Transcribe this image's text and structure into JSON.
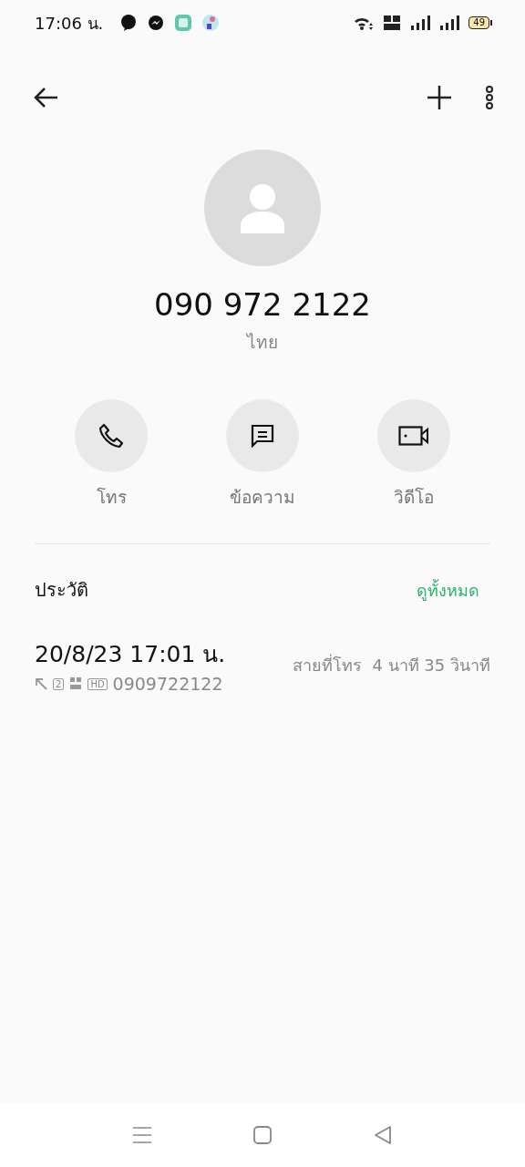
{
  "status_bar": {
    "time": "17:06 น.",
    "battery": "49"
  },
  "contact": {
    "number": "090 972 2122",
    "location": "ไทย"
  },
  "actions": [
    {
      "kind": "call",
      "label": "โทร"
    },
    {
      "kind": "message",
      "label": "ข้อความ"
    },
    {
      "kind": "video",
      "label": "วิดีโอ"
    }
  ],
  "history": {
    "title": "ประวัติ",
    "see_all": "ดูทั้งหมด",
    "entries": [
      {
        "datetime": "20/8/23 17:01 น.",
        "sim": "2",
        "quality": "HD",
        "number": "0909722122",
        "type": "สายที่โทร",
        "duration": "4 นาที 35 วินาที"
      }
    ]
  }
}
